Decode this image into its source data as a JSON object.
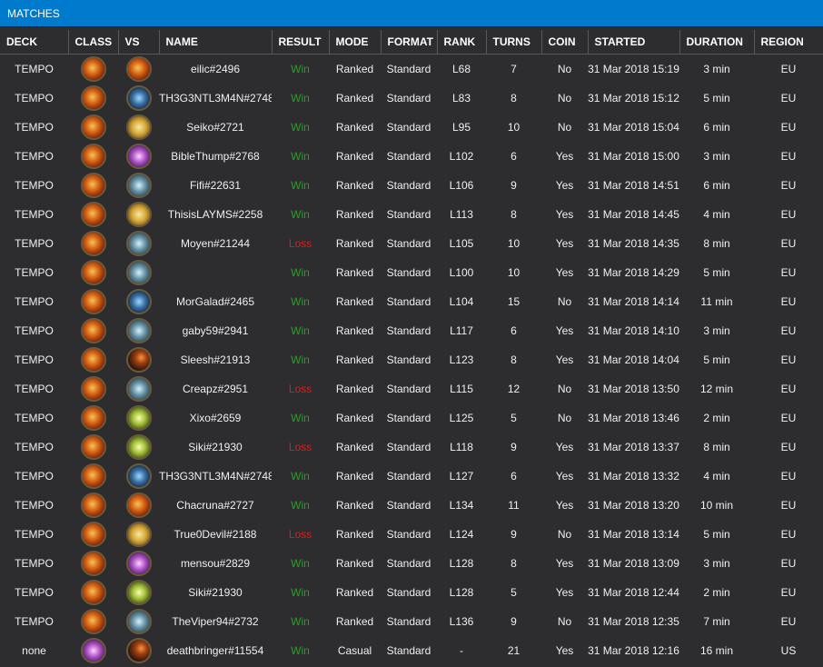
{
  "title": "MATCHES",
  "columns": [
    "DECK",
    "CLASS",
    "VS",
    "NAME",
    "RESULT",
    "MODE",
    "FORMAT",
    "RANK",
    "TURNS",
    "COIN",
    "STARTED",
    "DURATION",
    "REGION"
  ],
  "colors": {
    "accent": "#007acc",
    "win": "#2c9c2c",
    "loss": "#e01b1b",
    "background": "#2d2d30"
  },
  "rows": [
    {
      "deck": "TEMPO",
      "cls": "rogue",
      "vs": "rogue",
      "name": "eilic#2496",
      "result": "Win",
      "mode": "Ranked",
      "format": "Standard",
      "rank": "L68",
      "turns": "7",
      "coin": "No",
      "started": "31 Mar 2018 15:19",
      "duration": "3 min",
      "region": "EU"
    },
    {
      "deck": "TEMPO",
      "cls": "rogue",
      "vs": "warrior",
      "name": "TH3G3NTL3M4N#2748",
      "result": "Win",
      "mode": "Ranked",
      "format": "Standard",
      "rank": "L83",
      "turns": "8",
      "coin": "No",
      "started": "31 Mar 2018 15:12",
      "duration": "5 min",
      "region": "EU"
    },
    {
      "deck": "TEMPO",
      "cls": "rogue",
      "vs": "paladin",
      "name": "Seiko#2721",
      "result": "Win",
      "mode": "Ranked",
      "format": "Standard",
      "rank": "L95",
      "turns": "10",
      "coin": "No",
      "started": "31 Mar 2018 15:04",
      "duration": "6 min",
      "region": "EU"
    },
    {
      "deck": "TEMPO",
      "cls": "rogue",
      "vs": "priest",
      "name": "BibleThump#2768",
      "result": "Win",
      "mode": "Ranked",
      "format": "Standard",
      "rank": "L102",
      "turns": "6",
      "coin": "Yes",
      "started": "31 Mar 2018 15:00",
      "duration": "3 min",
      "region": "EU"
    },
    {
      "deck": "TEMPO",
      "cls": "rogue",
      "vs": "mage",
      "name": "Fifi#22631",
      "result": "Win",
      "mode": "Ranked",
      "format": "Standard",
      "rank": "L106",
      "turns": "9",
      "coin": "Yes",
      "started": "31 Mar 2018 14:51",
      "duration": "6 min",
      "region": "EU"
    },
    {
      "deck": "TEMPO",
      "cls": "rogue",
      "vs": "paladin",
      "name": "ThisisLAYMS#2258",
      "result": "Win",
      "mode": "Ranked",
      "format": "Standard",
      "rank": "L113",
      "turns": "8",
      "coin": "Yes",
      "started": "31 Mar 2018 14:45",
      "duration": "4 min",
      "region": "EU"
    },
    {
      "deck": "TEMPO",
      "cls": "rogue",
      "vs": "mage",
      "name": "Moyen#21244",
      "result": "Loss",
      "mode": "Ranked",
      "format": "Standard",
      "rank": "L105",
      "turns": "10",
      "coin": "Yes",
      "started": "31 Mar 2018 14:35",
      "duration": "8 min",
      "region": "EU"
    },
    {
      "deck": "TEMPO",
      "cls": "rogue",
      "vs": "mage",
      "name": "",
      "result": "Win",
      "mode": "Ranked",
      "format": "Standard",
      "rank": "L100",
      "turns": "10",
      "coin": "Yes",
      "started": "31 Mar 2018 14:29",
      "duration": "5 min",
      "region": "EU"
    },
    {
      "deck": "TEMPO",
      "cls": "rogue",
      "vs": "warrior",
      "name": "MorGalad#2465",
      "result": "Win",
      "mode": "Ranked",
      "format": "Standard",
      "rank": "L104",
      "turns": "15",
      "coin": "No",
      "started": "31 Mar 2018 14:14",
      "duration": "11 min",
      "region": "EU"
    },
    {
      "deck": "TEMPO",
      "cls": "rogue",
      "vs": "mage",
      "name": "gaby59#2941",
      "result": "Win",
      "mode": "Ranked",
      "format": "Standard",
      "rank": "L117",
      "turns": "6",
      "coin": "Yes",
      "started": "31 Mar 2018 14:10",
      "duration": "3 min",
      "region": "EU"
    },
    {
      "deck": "TEMPO",
      "cls": "rogue",
      "vs": "hunter",
      "name": "Sleesh#21913",
      "result": "Win",
      "mode": "Ranked",
      "format": "Standard",
      "rank": "L123",
      "turns": "8",
      "coin": "Yes",
      "started": "31 Mar 2018 14:04",
      "duration": "5 min",
      "region": "EU"
    },
    {
      "deck": "TEMPO",
      "cls": "rogue",
      "vs": "mage",
      "name": "Creapz#2951",
      "result": "Loss",
      "mode": "Ranked",
      "format": "Standard",
      "rank": "L115",
      "turns": "12",
      "coin": "No",
      "started": "31 Mar 2018 13:50",
      "duration": "12 min",
      "region": "EU"
    },
    {
      "deck": "TEMPO",
      "cls": "rogue",
      "vs": "druid",
      "name": "Xixo#2659",
      "result": "Win",
      "mode": "Ranked",
      "format": "Standard",
      "rank": "L125",
      "turns": "5",
      "coin": "No",
      "started": "31 Mar 2018 13:46",
      "duration": "2 min",
      "region": "EU"
    },
    {
      "deck": "TEMPO",
      "cls": "rogue",
      "vs": "druid",
      "name": "Siki#21930",
      "result": "Loss",
      "mode": "Ranked",
      "format": "Standard",
      "rank": "L118",
      "turns": "9",
      "coin": "Yes",
      "started": "31 Mar 2018 13:37",
      "duration": "8 min",
      "region": "EU"
    },
    {
      "deck": "TEMPO",
      "cls": "rogue",
      "vs": "warrior",
      "name": "TH3G3NTL3M4N#2748",
      "result": "Win",
      "mode": "Ranked",
      "format": "Standard",
      "rank": "L127",
      "turns": "6",
      "coin": "Yes",
      "started": "31 Mar 2018 13:32",
      "duration": "4 min",
      "region": "EU"
    },
    {
      "deck": "TEMPO",
      "cls": "rogue",
      "vs": "rogue",
      "name": "Chacruna#2727",
      "result": "Win",
      "mode": "Ranked",
      "format": "Standard",
      "rank": "L134",
      "turns": "11",
      "coin": "Yes",
      "started": "31 Mar 2018 13:20",
      "duration": "10 min",
      "region": "EU"
    },
    {
      "deck": "TEMPO",
      "cls": "rogue",
      "vs": "paladin",
      "name": "True0Devil#2188",
      "result": "Loss",
      "mode": "Ranked",
      "format": "Standard",
      "rank": "L124",
      "turns": "9",
      "coin": "No",
      "started": "31 Mar 2018 13:14",
      "duration": "5 min",
      "region": "EU"
    },
    {
      "deck": "TEMPO",
      "cls": "rogue",
      "vs": "priest",
      "name": "mensou#2829",
      "result": "Win",
      "mode": "Ranked",
      "format": "Standard",
      "rank": "L128",
      "turns": "8",
      "coin": "Yes",
      "started": "31 Mar 2018 13:09",
      "duration": "3 min",
      "region": "EU"
    },
    {
      "deck": "TEMPO",
      "cls": "rogue",
      "vs": "druid",
      "name": "Siki#21930",
      "result": "Win",
      "mode": "Ranked",
      "format": "Standard",
      "rank": "L128",
      "turns": "5",
      "coin": "Yes",
      "started": "31 Mar 2018 12:44",
      "duration": "2 min",
      "region": "EU"
    },
    {
      "deck": "TEMPO",
      "cls": "rogue",
      "vs": "mage",
      "name": "TheViper94#2732",
      "result": "Win",
      "mode": "Ranked",
      "format": "Standard",
      "rank": "L136",
      "turns": "9",
      "coin": "No",
      "started": "31 Mar 2018 12:35",
      "duration": "7 min",
      "region": "EU"
    },
    {
      "deck": "none",
      "cls": "priest",
      "vs": "hunter",
      "name": "deathbringer#11554",
      "result": "Win",
      "mode": "Casual",
      "format": "Standard",
      "rank": "-",
      "turns": "21",
      "coin": "Yes",
      "started": "31 Mar 2018 12:16",
      "duration": "16 min",
      "region": "US"
    }
  ]
}
